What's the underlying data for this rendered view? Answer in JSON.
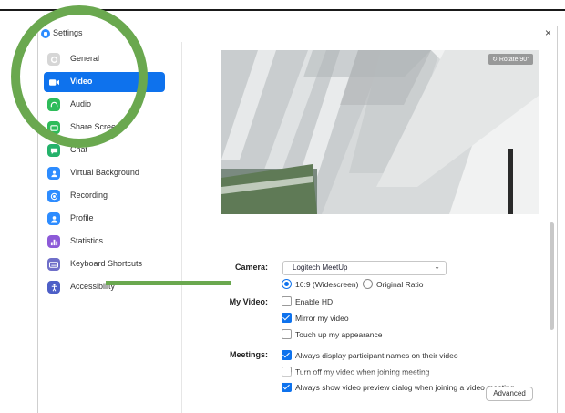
{
  "window": {
    "title": "Settings",
    "close_glyph": "×"
  },
  "sidebar": {
    "items": [
      {
        "label": "General",
        "icon": "gear-icon",
        "color": "#c9c9c9"
      },
      {
        "label": "Video",
        "icon": "video-camera-icon",
        "color": "#ffffff",
        "active": true
      },
      {
        "label": "Audio",
        "icon": "headphones-icon",
        "color": "#2ebc5a"
      },
      {
        "label": "Share Screen",
        "icon": "share-screen-icon",
        "color": "#2ebc5a"
      },
      {
        "label": "Chat",
        "icon": "chat-bubble-icon",
        "color": "#24b26b"
      },
      {
        "label": "Virtual Background",
        "icon": "person-background-icon",
        "color": "#2d8cff"
      },
      {
        "label": "Recording",
        "icon": "record-icon",
        "color": "#2d8cff"
      },
      {
        "label": "Profile",
        "icon": "profile-icon",
        "color": "#2d8cff"
      },
      {
        "label": "Statistics",
        "icon": "bar-chart-icon",
        "color": "#8d5ad8"
      },
      {
        "label": "Keyboard Shortcuts",
        "icon": "keyboard-icon",
        "color": "#6f6fc9"
      },
      {
        "label": "Accessibility",
        "icon": "accessibility-icon",
        "color": "#4d5fc7"
      }
    ]
  },
  "preview": {
    "rotate_label": "Rotate 90°"
  },
  "camera": {
    "label": "Camera:",
    "selected": "Logitech MeetUp"
  },
  "ratio": [
    {
      "label": "16:9 (Widescreen)",
      "checked": true
    },
    {
      "label": "Original Ratio",
      "checked": false
    }
  ],
  "my_video": {
    "label": "My Video:",
    "options": [
      {
        "label": "Enable HD",
        "checked": false
      },
      {
        "label": "Mirror my video",
        "checked": true
      },
      {
        "label": "Touch up my appearance",
        "checked": false
      }
    ]
  },
  "meetings": {
    "label": "Meetings:",
    "options": [
      {
        "label": "Always display participant names on their video",
        "checked": true
      },
      {
        "label": "Turn off my video when joining meeting",
        "checked": false
      },
      {
        "label": "Always show video preview dialog when joining a video meeting",
        "checked": true
      }
    ]
  },
  "advanced_label": "Advanced",
  "annotation_color": "#6aa84f"
}
